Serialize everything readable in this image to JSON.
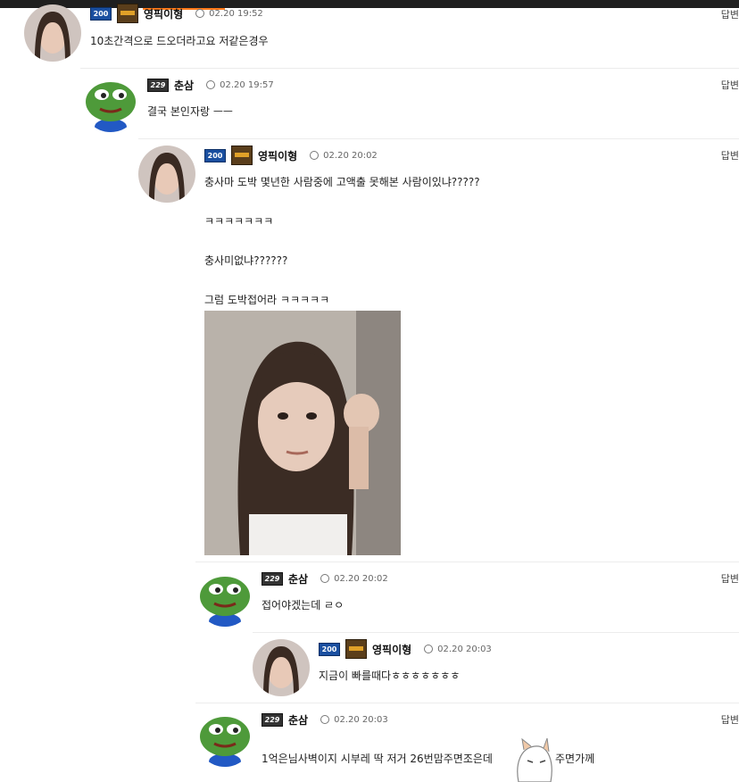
{
  "reply_label": "답변",
  "comments": [
    {
      "nick": "영픽이형",
      "time": "02.20 19:52",
      "level": "200",
      "has_item_icon": true,
      "lines": [
        "10초간격으로 드오더라고요 저같은경우"
      ]
    },
    {
      "nick": "춘삼",
      "time": "02.20 19:57",
      "level": "229",
      "has_item_icon": false,
      "lines": [
        "결국 본인자랑 ㅡㅡ"
      ]
    },
    {
      "nick": "영픽이형",
      "time": "02.20 20:02",
      "level": "200",
      "has_item_icon": true,
      "lines": [
        "충사마 도박 몇년한 사람중에 고액출 못해본 사람이있냐?????",
        "ㅋㅋㅋㅋㅋㅋㅋ",
        "충사미없냐??????",
        "그럼 도박접어라 ㅋㅋㅋㅋㅋ"
      ]
    },
    {
      "nick": "춘삼",
      "time": "02.20 20:02",
      "level": "229",
      "has_item_icon": false,
      "lines": [
        "접어야겠는데 ㄹㅇ"
      ]
    },
    {
      "nick": "영픽이형",
      "time": "02.20 20:03",
      "level": "200",
      "has_item_icon": true,
      "lines": [
        "지금이 빠를때다ㅎㅎㅎㅎㅎㅎㅎ"
      ]
    },
    {
      "nick": "춘삼",
      "time": "02.20 20:03",
      "level": "229",
      "has_item_icon": false,
      "lines": [
        "1억은님사벽이지 시부레 딱 저거 26번맘주면조은데",
        "주면가께"
      ]
    }
  ],
  "colors": {
    "topbar": "#1f1f1f",
    "accent": "#ff7a1a",
    "badge200": "#1a4fa0",
    "badge229": "#333333"
  }
}
